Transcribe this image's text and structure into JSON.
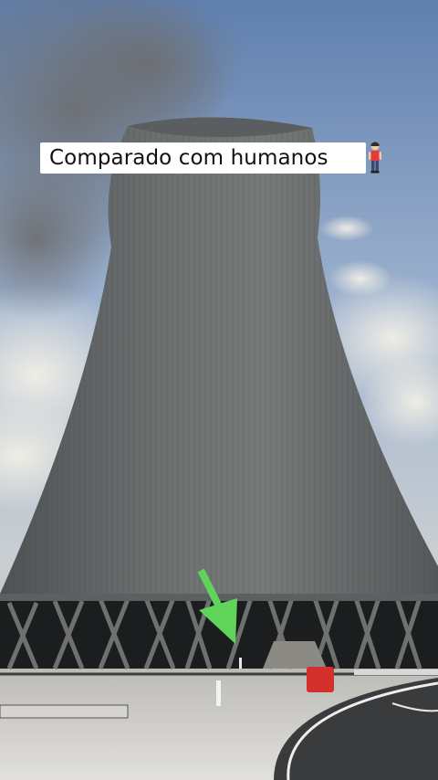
{
  "caption": {
    "text": "Comparado com humanos",
    "emoji_icon": "standing-person-icon"
  },
  "arrow": {
    "color": "#5fd35a",
    "icon": "down-arrow-icon"
  }
}
